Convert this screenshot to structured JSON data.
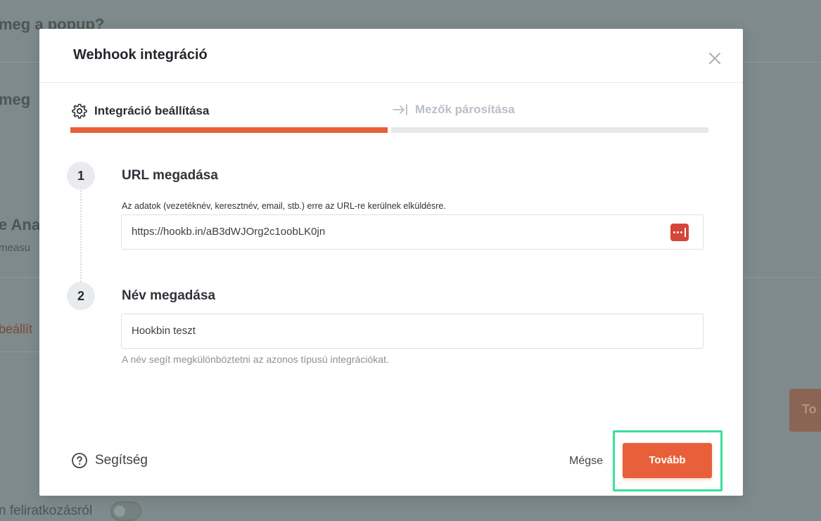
{
  "background": {
    "fragments": [
      "meg a popup?",
      "meg",
      "e Ana",
      "measu",
      "beállít",
      "To",
      "n feliratkozásról"
    ]
  },
  "modal": {
    "title": "Webhook integráció",
    "close_icon": "close-icon",
    "steps_tabs": [
      {
        "label": "Integráció beállítása",
        "icon": "gear-icon",
        "state": "active"
      },
      {
        "label": "Mezők párosítása",
        "icon": "arrow-to-bar-icon",
        "state": "inactive"
      }
    ],
    "progress_completed_fraction": 0.5,
    "accent_color": "#e8603a",
    "step1": {
      "number": "1",
      "title": "URL megadása",
      "label": "Az adatok (vezetéknév, keresztnév, email, stb.) erre az URL-re kerülnek elküldésre.",
      "value": "https://hookb.in/aB3dWJOrg2c1oobLK0jn"
    },
    "step2": {
      "number": "2",
      "title": "Név megadása",
      "value": "Hookbin teszt",
      "hint": "A név segít megkülönböztetni az azonos típusú integrációkat."
    },
    "footer": {
      "help_label": "Segítség",
      "cancel_label": "Mégse",
      "next_label": "Tovább"
    }
  }
}
